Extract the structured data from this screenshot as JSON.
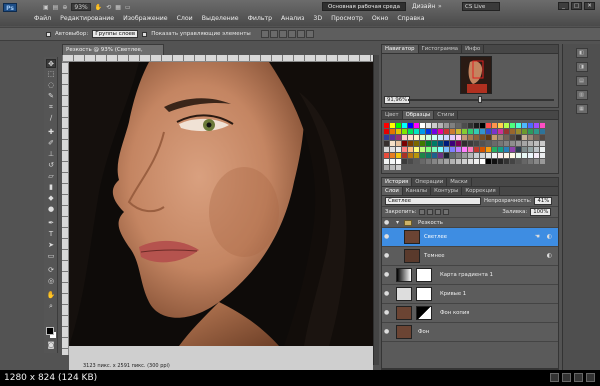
{
  "app": {
    "logo": "Ps",
    "zoom": "93%",
    "workspace": "Основная рабочая среда",
    "design_label": "Дизайн",
    "more_arrow": "»",
    "cs_live": "CS Live",
    "window_controls": [
      "_",
      "□",
      "✕"
    ]
  },
  "menu": {
    "items": [
      "Файл",
      "Редактирование",
      "Изображение",
      "Слои",
      "Выделение",
      "Фильтр",
      "Анализ",
      "3D",
      "Просмотр",
      "Окно",
      "Справка"
    ]
  },
  "options": {
    "auto_select_label": "Автовыбор:",
    "auto_select_value": "Группы слоев",
    "show_controls_label": "Показать управляющие элементы"
  },
  "document": {
    "tab_title": "Резкость @ 93% (Светлее, RGB/8) *",
    "tab_close": "×",
    "status": "3123 пикс. x 2591 пикс. (300 ppi)"
  },
  "navigator": {
    "tabs": [
      "Навигатор",
      "Гистограмма",
      "Инфо"
    ],
    "zoom": "91,96%"
  },
  "swatches": {
    "tabs": [
      "Цвет",
      "Образцы",
      "Стили"
    ],
    "colors": [
      "#ff0000",
      "#ffff00",
      "#00ff00",
      "#00ffff",
      "#0000ff",
      "#ff00ff",
      "#ffffff",
      "#e6e6e6",
      "#cccccc",
      "#b3b3b3",
      "#999999",
      "#808080",
      "#666666",
      "#4d4d4d",
      "#333333",
      "#1a1a1a",
      "#000000",
      "#ff4d4d",
      "#ff944d",
      "#ffd24d",
      "#b5ff4d",
      "#4dff7e",
      "#4dffd2",
      "#4db8ff",
      "#4d6bff",
      "#a04dff",
      "#ff4dc4",
      "#e60000",
      "#e67300",
      "#e6c200",
      "#7fe600",
      "#00e65c",
      "#00e6c2",
      "#0099e6",
      "#0033e6",
      "#7300e6",
      "#e600a0",
      "#cc3333",
      "#cc7a33",
      "#ccb833",
      "#85cc33",
      "#33cc70",
      "#33ccb3",
      "#3394cc",
      "#3347cc",
      "#7a33cc",
      "#cc3399",
      "#993333",
      "#99662e",
      "#998a2e",
      "#6b992e",
      "#2e995c",
      "#2e998a",
      "#2e7399",
      "#2e3d99",
      "#5c2e99",
      "#992e73",
      "#ffcccc",
      "#ffe0cc",
      "#fff5cc",
      "#e6ffcc",
      "#ccffdd",
      "#ccfff5",
      "#cce8ff",
      "#ccd6ff",
      "#e6ccff",
      "#ffccf0",
      "#c79a7a",
      "#a67c52",
      "#8c6239",
      "#754c24",
      "#603813",
      "#c69c6d",
      "#998675",
      "#736357",
      "#534741",
      "#362f2d",
      "#c7b299",
      "#998675",
      "#736357",
      "#534741",
      "#362f2d",
      "#f5e1c8",
      "#e8c39e",
      "#7a0000",
      "#7a3d00",
      "#7a6600",
      "#3f7a00",
      "#007a30",
      "#007a66",
      "#00517a",
      "#001b7a",
      "#3d007a",
      "#7a0052",
      "#2e2e2e",
      "#3a3a3a",
      "#464646",
      "#525252",
      "#5e5e5e",
      "#6a6a6a",
      "#767676",
      "#828282",
      "#8e8e8e",
      "#9a9a9a",
      "#a6a6a6",
      "#b2b2b2",
      "#bebebe",
      "#cacaca",
      "#d6d6d6",
      "#e2e2e2",
      "#eeeeee",
      "#ff7f7f",
      "#ffbf7f",
      "#ffff7f",
      "#bfff7f",
      "#7fff7f",
      "#7fffbf",
      "#7fffff",
      "#7fbfff",
      "#7f7fff",
      "#bf7fff",
      "#ff7fff",
      "#ff7fbf",
      "#c0392b",
      "#d35400",
      "#f39c12",
      "#27ae60",
      "#16a085",
      "#2980b9",
      "#8e44ad",
      "#2c3e50",
      "#7f8c8d",
      "#95a5a6",
      "#bdc3c7",
      "#ecf0f1",
      "#e74c3c",
      "#e67e22",
      "#f1c40f",
      "#a93226",
      "#b9770e",
      "#b7950b",
      "#1e8449",
      "#117864",
      "#1f618d",
      "#6c3483",
      "#1b2631",
      "#616a6b",
      "#7b7d7d",
      "#979a9a",
      "#b3b6b7",
      "#cacfd2",
      "#d0d3d4",
      "#e5e8e8",
      "#f2f3f4",
      "#fdedec",
      "#fef5e7",
      "#fef9e7",
      "#eafaf1",
      "#e8f8f5",
      "#ebf5fb",
      "#f4ecf7",
      "#eaecee",
      "#f2f4f4",
      "#f4f6f6",
      "#ffffff",
      "#3b3b3b",
      "#4a4a4a",
      "#595959",
      "#686868",
      "#777777",
      "#868686",
      "#959595",
      "#a4a4a4",
      "#b3b3b3",
      "#c2c2c2",
      "#d1d1d1",
      "#e0e0e0",
      "#efefef",
      "#ffffff",
      "#000000",
      "#111111",
      "#222222",
      "#333333",
      "#444444",
      "#555555",
      "#666666",
      "#777777",
      "#888888",
      "#999999",
      "#aaaaaa",
      "#bbbbbb",
      "#cccccc"
    ]
  },
  "layers_panel": {
    "tabs": [
      "История",
      "Операции",
      "Маски"
    ],
    "subtabs": [
      "Слои",
      "Каналы",
      "Контуры",
      "Коррекция"
    ],
    "blend_mode": "Светлее",
    "opacity_label": "Непрозрачность:",
    "opacity_value": "41%",
    "lock_label": "Закрепить:",
    "fill_label": "Заливка:",
    "fill_value": "100%",
    "group_name": "Резкость",
    "layers": [
      {
        "name": "Светлее",
        "selected": true
      },
      {
        "name": "Темнее",
        "selected": false
      },
      {
        "name": "Карта градиента 1",
        "selected": false
      },
      {
        "name": "Кривые 1",
        "selected": false
      },
      {
        "name": "Фон копия",
        "selected": false
      },
      {
        "name": "Фон",
        "selected": false
      }
    ]
  },
  "caption": {
    "text": "1280 x 824 (124 KB)"
  }
}
